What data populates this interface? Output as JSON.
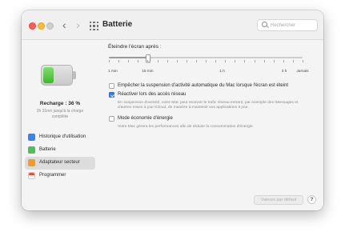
{
  "window": {
    "title": "Batterie",
    "search_placeholder": "Rechercher",
    "nav_back_icon": "chevron-left",
    "nav_forward_icon": "chevron-right",
    "grid_icon": "grid-dots"
  },
  "sidebar": {
    "battery_level_percent": 36,
    "charge_label": "Recharge : 36 %",
    "charge_sub": "2h 31mn jusqu'à la charge complète",
    "items": [
      {
        "label": "Historique d'utilisation",
        "icon": "chart-bar-icon",
        "color": "#3b82f6",
        "active": false
      },
      {
        "label": "Batterie",
        "icon": "battery-icon",
        "color": "#4cc15a",
        "active": false
      },
      {
        "label": "Adaptateur secteur",
        "icon": "power-plug-icon",
        "color": "#f59a24",
        "active": true
      },
      {
        "label": "Programmer",
        "icon": "calendar-icon",
        "color": "#ef4a3c",
        "active": false
      }
    ]
  },
  "settings": {
    "section_title": "Éteindre l'écran après :",
    "slider": {
      "value_fraction": 0.2,
      "tick_labels": [
        "1 min",
        "15 min",
        "1 h",
        "3 h",
        "Jamais"
      ]
    },
    "options": [
      {
        "label": "Empêcher la suspension d'activité automatique du Mac lorsque l'écran est éteint",
        "checked": false,
        "description": ""
      },
      {
        "label": "Réactiver lors des accès réseau",
        "checked": true,
        "description": "En suspension d'activité, votre Mac peut recevoir le trafic réseau entrant, par exemple des iMessages et d'autres mises à jour iCloud, de manière à maintenir vos applications à jour."
      },
      {
        "label": "Mode économie d'énergie",
        "checked": false,
        "description": "Votre Mac gérera les performances afin de réduire la consommation d'énergie."
      }
    ]
  },
  "footer": {
    "defaults_button": "Valeurs par défaut",
    "help_button": "?"
  },
  "colors": {
    "accent": "#2f7cf6",
    "active_item_bg": "#dcdcdc",
    "battery_fill": "#4cc15a"
  }
}
